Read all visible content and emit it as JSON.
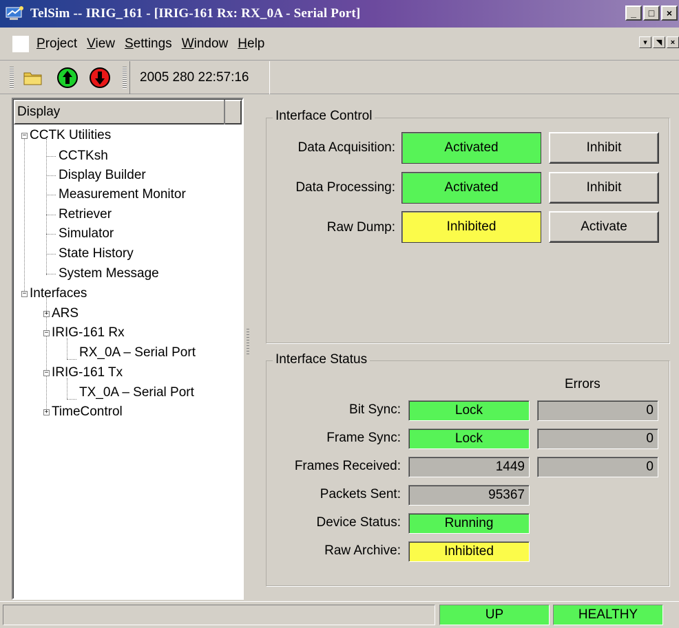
{
  "window": {
    "title": "TelSim -- IRIG_161 - [IRIG-161 Rx: RX_0A - Serial Port]",
    "controls": [
      "_",
      "□",
      "×"
    ]
  },
  "menu": {
    "items": [
      {
        "underline": "P",
        "rest": "roject"
      },
      {
        "underline": "V",
        "rest": "iew"
      },
      {
        "underline": "S",
        "rest": "ettings"
      },
      {
        "underline": "W",
        "rest": "indow"
      },
      {
        "underline": "H",
        "rest": "elp"
      }
    ],
    "mdi_controls": [
      "▾",
      "◥",
      "×"
    ]
  },
  "toolbar": {
    "open_icon": "folder-icon",
    "up_icon": "green-up-arrow-icon",
    "down_icon": "red-down-arrow-icon",
    "timestamp": "2005 280 22:57:16"
  },
  "tree": {
    "header": "Display",
    "nodes": {
      "cctk_utilities": "CCTK Utilities",
      "cctksh": "CCTKsh",
      "display_builder": "Display Builder",
      "measurement_monitor": "Measurement Monitor",
      "retriever": "Retriever",
      "simulator": "Simulator",
      "state_history": "State History",
      "system_message": "System Message",
      "interfaces": "Interfaces",
      "ars": "ARS",
      "irig_rx": "IRIG-161 Rx",
      "rx_serial": "RX_0A – Serial Port",
      "irig_tx": "IRIG-161 Tx",
      "tx_serial": "TX_0A – Serial Port",
      "time_control": "TimeControl"
    }
  },
  "interface_control": {
    "title": "Interface Control",
    "rows": [
      {
        "label": "Data Acquisition:",
        "state": "Activated",
        "state_color": "#57f357",
        "button": "Inhibit"
      },
      {
        "label": "Data Processing:",
        "state": "Activated",
        "state_color": "#57f357",
        "button": "Inhibit"
      },
      {
        "label": "Raw Dump:",
        "state": "Inhibited",
        "state_color": "#fbfb4a",
        "button": "Activate"
      }
    ]
  },
  "interface_status": {
    "title": "Interface Status",
    "errors_header": "Errors",
    "rows": [
      {
        "label": "Bit Sync:",
        "value": "Lock",
        "color": "#57f357",
        "error": "0"
      },
      {
        "label": "Frame Sync:",
        "value": "Lock",
        "color": "#57f357",
        "error": "0"
      },
      {
        "label": "Frames Received:",
        "value": "1449",
        "color": "#b8b6b0",
        "error": "0"
      },
      {
        "label": "Packets Sent:",
        "value": "95367",
        "color": "#b8b6b0"
      },
      {
        "label": "Device Status:",
        "value": "Running",
        "color": "#57f357"
      },
      {
        "label": "Raw Archive:",
        "value": "Inhibited",
        "color": "#fbfb4a"
      }
    ]
  },
  "statusbar": {
    "link": "UP",
    "health": "HEALTHY",
    "color": "#57f357"
  }
}
